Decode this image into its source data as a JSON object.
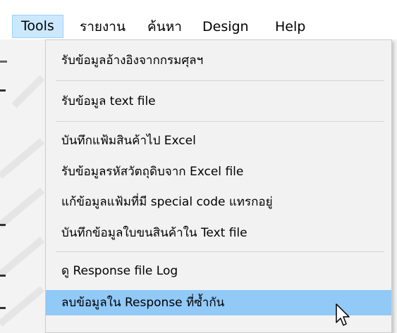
{
  "menubar": {
    "items": [
      {
        "label": "Tools",
        "active": true
      },
      {
        "label": "รายงาน"
      },
      {
        "label": "ค้นหา"
      },
      {
        "label": "Design"
      },
      {
        "label": "Help"
      }
    ]
  },
  "tools_menu": {
    "items": [
      {
        "label": "รับข้อมูลอ้างอิงจากกรมศุลฯ"
      },
      {
        "label": "รับข้อมูล text file"
      },
      {
        "label": "บันทึกแฟ้มสินค้าไป Excel"
      },
      {
        "label": "รับข้อมูลรหัสวัตถุดิบจาก Excel file"
      },
      {
        "label": "แก้ข้อมูลแฟ้มที่มี special code แทรกอยู่"
      },
      {
        "label": "บันทึกข้อมูลใบขนสินค้าใน Text file"
      },
      {
        "label": "ดู Response file Log"
      },
      {
        "label": "ลบข้อมูลใน Response ที่ซ้ำกัน",
        "highlighted": true
      }
    ]
  },
  "colors": {
    "highlight": "#91c9f7",
    "active_menu_bg": "#cce8ff",
    "active_menu_border": "#99d1ff",
    "menu_bg": "#f2f2f2"
  },
  "icons": {
    "cursor": "mouse-pointer-icon"
  }
}
